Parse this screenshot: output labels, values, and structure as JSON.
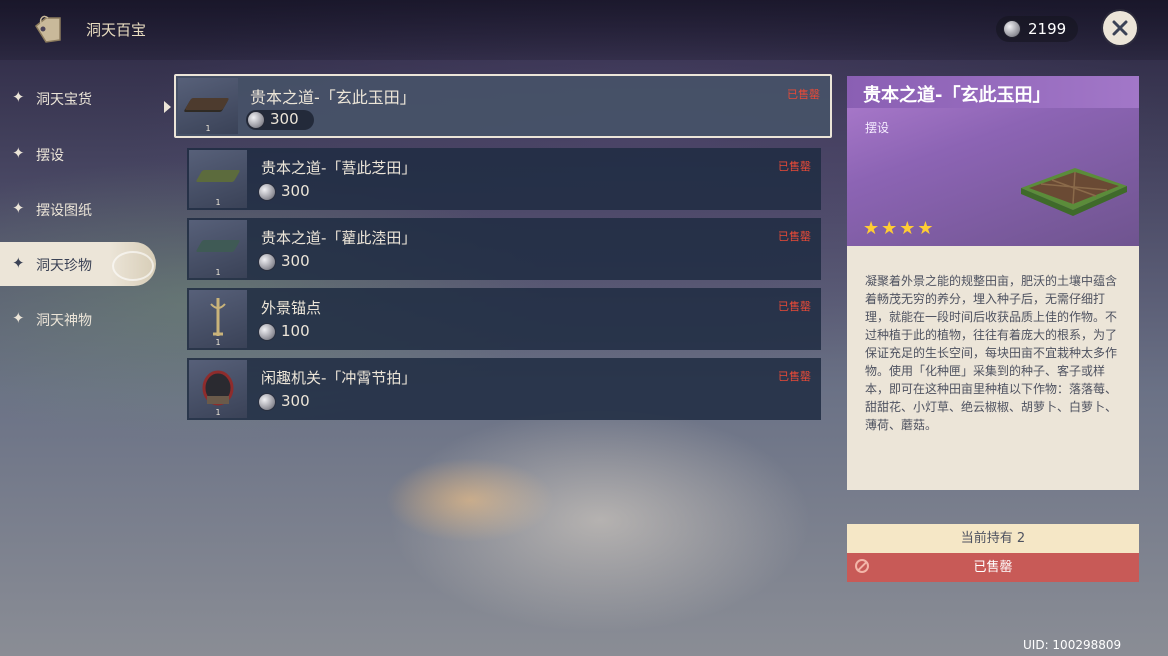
{
  "header": {
    "title": "洞天百宝",
    "currency_value": "2199",
    "icons": {
      "shop": "tag-icon",
      "currency": "coin-icon",
      "close": "close-icon"
    }
  },
  "sidebar": {
    "items": [
      {
        "label": "洞天宝货",
        "active": false
      },
      {
        "label": "摆设",
        "active": false
      },
      {
        "label": "摆设图纸",
        "active": false
      },
      {
        "label": "洞天珍物",
        "active": true
      },
      {
        "label": "洞天神物",
        "active": false
      }
    ]
  },
  "list": {
    "items": [
      {
        "name": "贵本之道-「玄此玉田」",
        "price": "300",
        "status": "已售罄",
        "qty": "1",
        "selected": true
      },
      {
        "name": "贵本之道-「䓊此芝田」",
        "price": "300",
        "status": "已售罄",
        "qty": "1",
        "selected": false
      },
      {
        "name": "贵本之道-「藋此淕田」",
        "price": "300",
        "status": "已售罄",
        "qty": "1",
        "selected": false
      },
      {
        "name": "外景锚点",
        "price": "100",
        "status": "已售罄",
        "qty": "1",
        "selected": false
      },
      {
        "name": "闲趣机关-「冲霄节拍」",
        "price": "300",
        "status": "已售罄",
        "qty": "1",
        "selected": false
      }
    ]
  },
  "detail": {
    "title": "贵本之道-「玄此玉田」",
    "category": "摆设",
    "rarity": "★★★★",
    "description": "凝聚着外景之能的规整田亩，肥沃的土壤中蕴含着畅茂无穷的养分，埋入种子后，无需仔细打理，就能在一段时间后收获品质上佳的作物。不过种植于此的植物，往往有着庞大的根系，为了保证充足的生长空间，每块田亩不宜栽种太多作物。使用「化种匣」采集到的种子、客子或样本，即可在这种田亩里种植以下作物：落落莓、甜甜花、小灯草、绝云椒椒、胡萝卜、白萝卜、薄荷、蘑菇。",
    "owned": "当前持有 2",
    "sold_label": "已售罄"
  },
  "footer": {
    "uid": "UID: 100298809"
  },
  "colors": {
    "accent_purple": "#8c64b4",
    "soldout_red": "#e84a37",
    "star_gold": "#ffcc33",
    "panel_cream": "#ece5d8"
  }
}
